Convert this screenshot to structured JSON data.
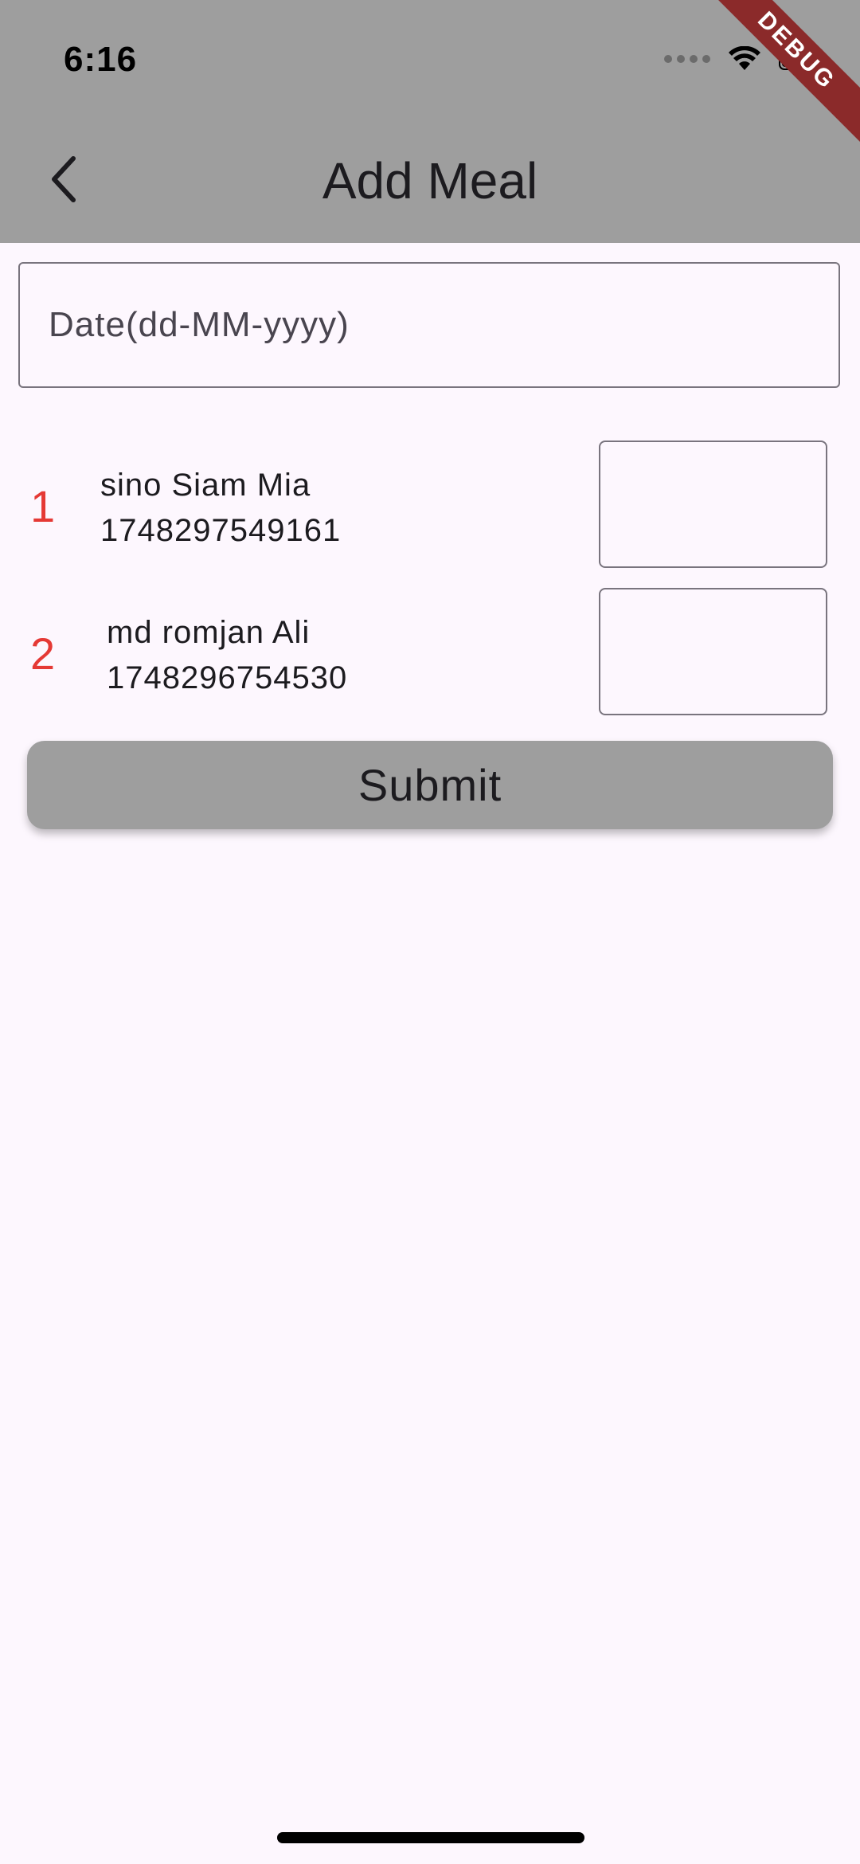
{
  "status_bar": {
    "time": "6:16",
    "debug_label": "DEBUG"
  },
  "app_bar": {
    "title": "Add Meal",
    "back_icon": "chevron-left-icon"
  },
  "form": {
    "date_placeholder": "Date(dd-MM-yyyy)",
    "date_value": ""
  },
  "members": [
    {
      "index": "1",
      "name": "sino Siam Mia",
      "phone": "1748297549161",
      "meal_value": ""
    },
    {
      "index": "2",
      "name": "md romjan Ali",
      "phone": "1748296754530",
      "meal_value": ""
    }
  ],
  "submit_label": "Submit",
  "colors": {
    "app_bar": "#9e9e9e",
    "background": "#fdf7fe",
    "index_red": "#e53935",
    "debug_ribbon": "#8b2a2a"
  }
}
